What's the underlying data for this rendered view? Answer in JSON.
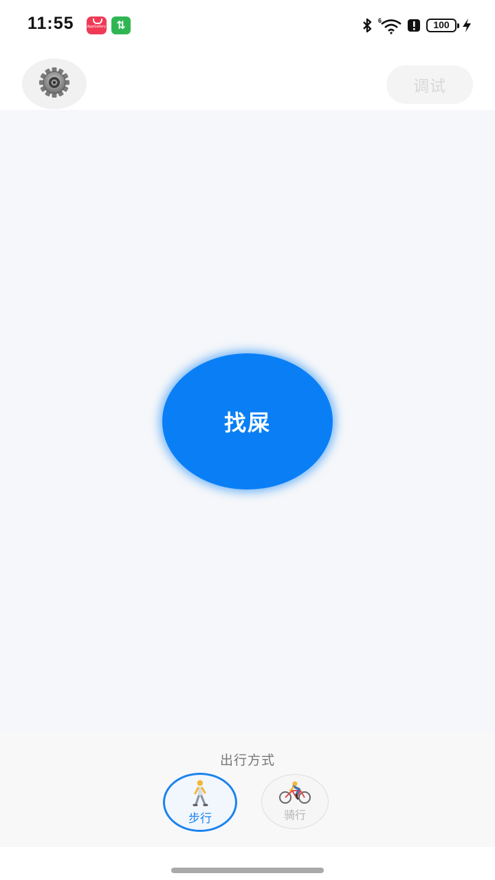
{
  "status_bar": {
    "time": "11:55",
    "app_gallery_label": "AppGallery",
    "sync_glyph": "⇅",
    "battery": "100",
    "icons": [
      "app-gallery-icon",
      "sync-icon",
      "bluetooth-icon",
      "wifi-icon",
      "alert-icon",
      "battery-icon",
      "charging-icon"
    ]
  },
  "top_bar": {
    "settings_icon": "gear-icon",
    "debug_label": "调试"
  },
  "main": {
    "find_toilet_label": "找屎",
    "find_toilet_color": "#0a7ff5"
  },
  "travel_mode": {
    "title": "出行方式",
    "options": [
      {
        "label": "步行",
        "icon": "walking-person-icon",
        "selected": true
      },
      {
        "label": "骑行",
        "icon": "cyclist-icon",
        "selected": false
      }
    ],
    "accent": "#1a83f0"
  }
}
